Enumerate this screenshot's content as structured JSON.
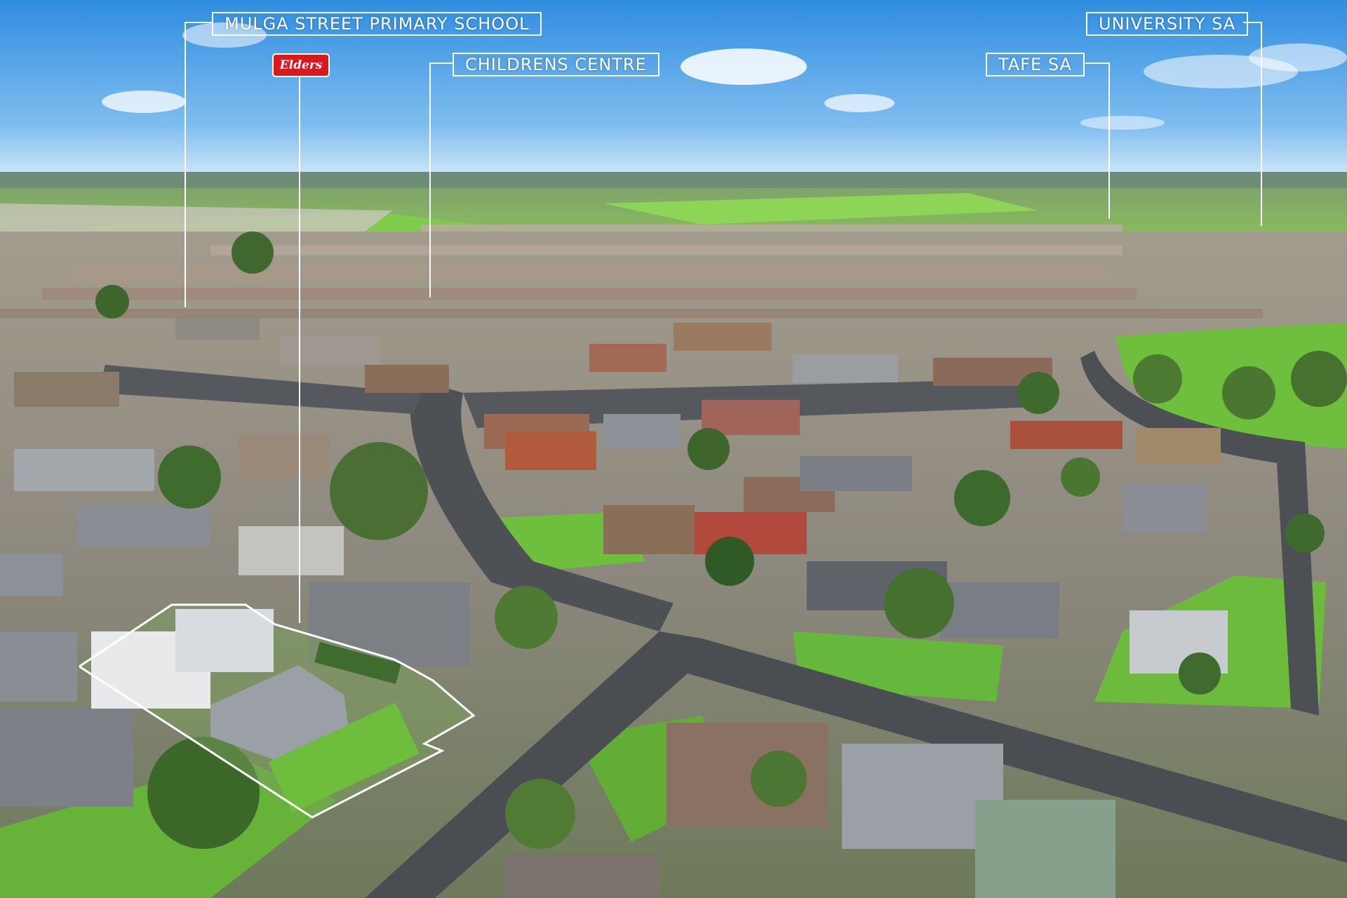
{
  "image": {
    "description_type": "aerial real estate photograph",
    "colors": {
      "sky_top": "#2f8de0",
      "sky_horizon": "#cfe6f7",
      "grass": "#6fbf3f",
      "road": "#4a4d52",
      "roof_grey": "#8c9198",
      "roof_terracotta": "#b25a3c",
      "label_line": "#ffffff",
      "elders_red": "#d71920"
    }
  },
  "labels": {
    "school": "MULGA STREET PRIMARY SCHOOL",
    "childrens_centre": "CHILDRENS CENTRE",
    "tafe": "TAFE SA",
    "university": "UNIVERSITY SA"
  },
  "logo": {
    "text": "Elders",
    "icon": "elders-logo-icon"
  }
}
